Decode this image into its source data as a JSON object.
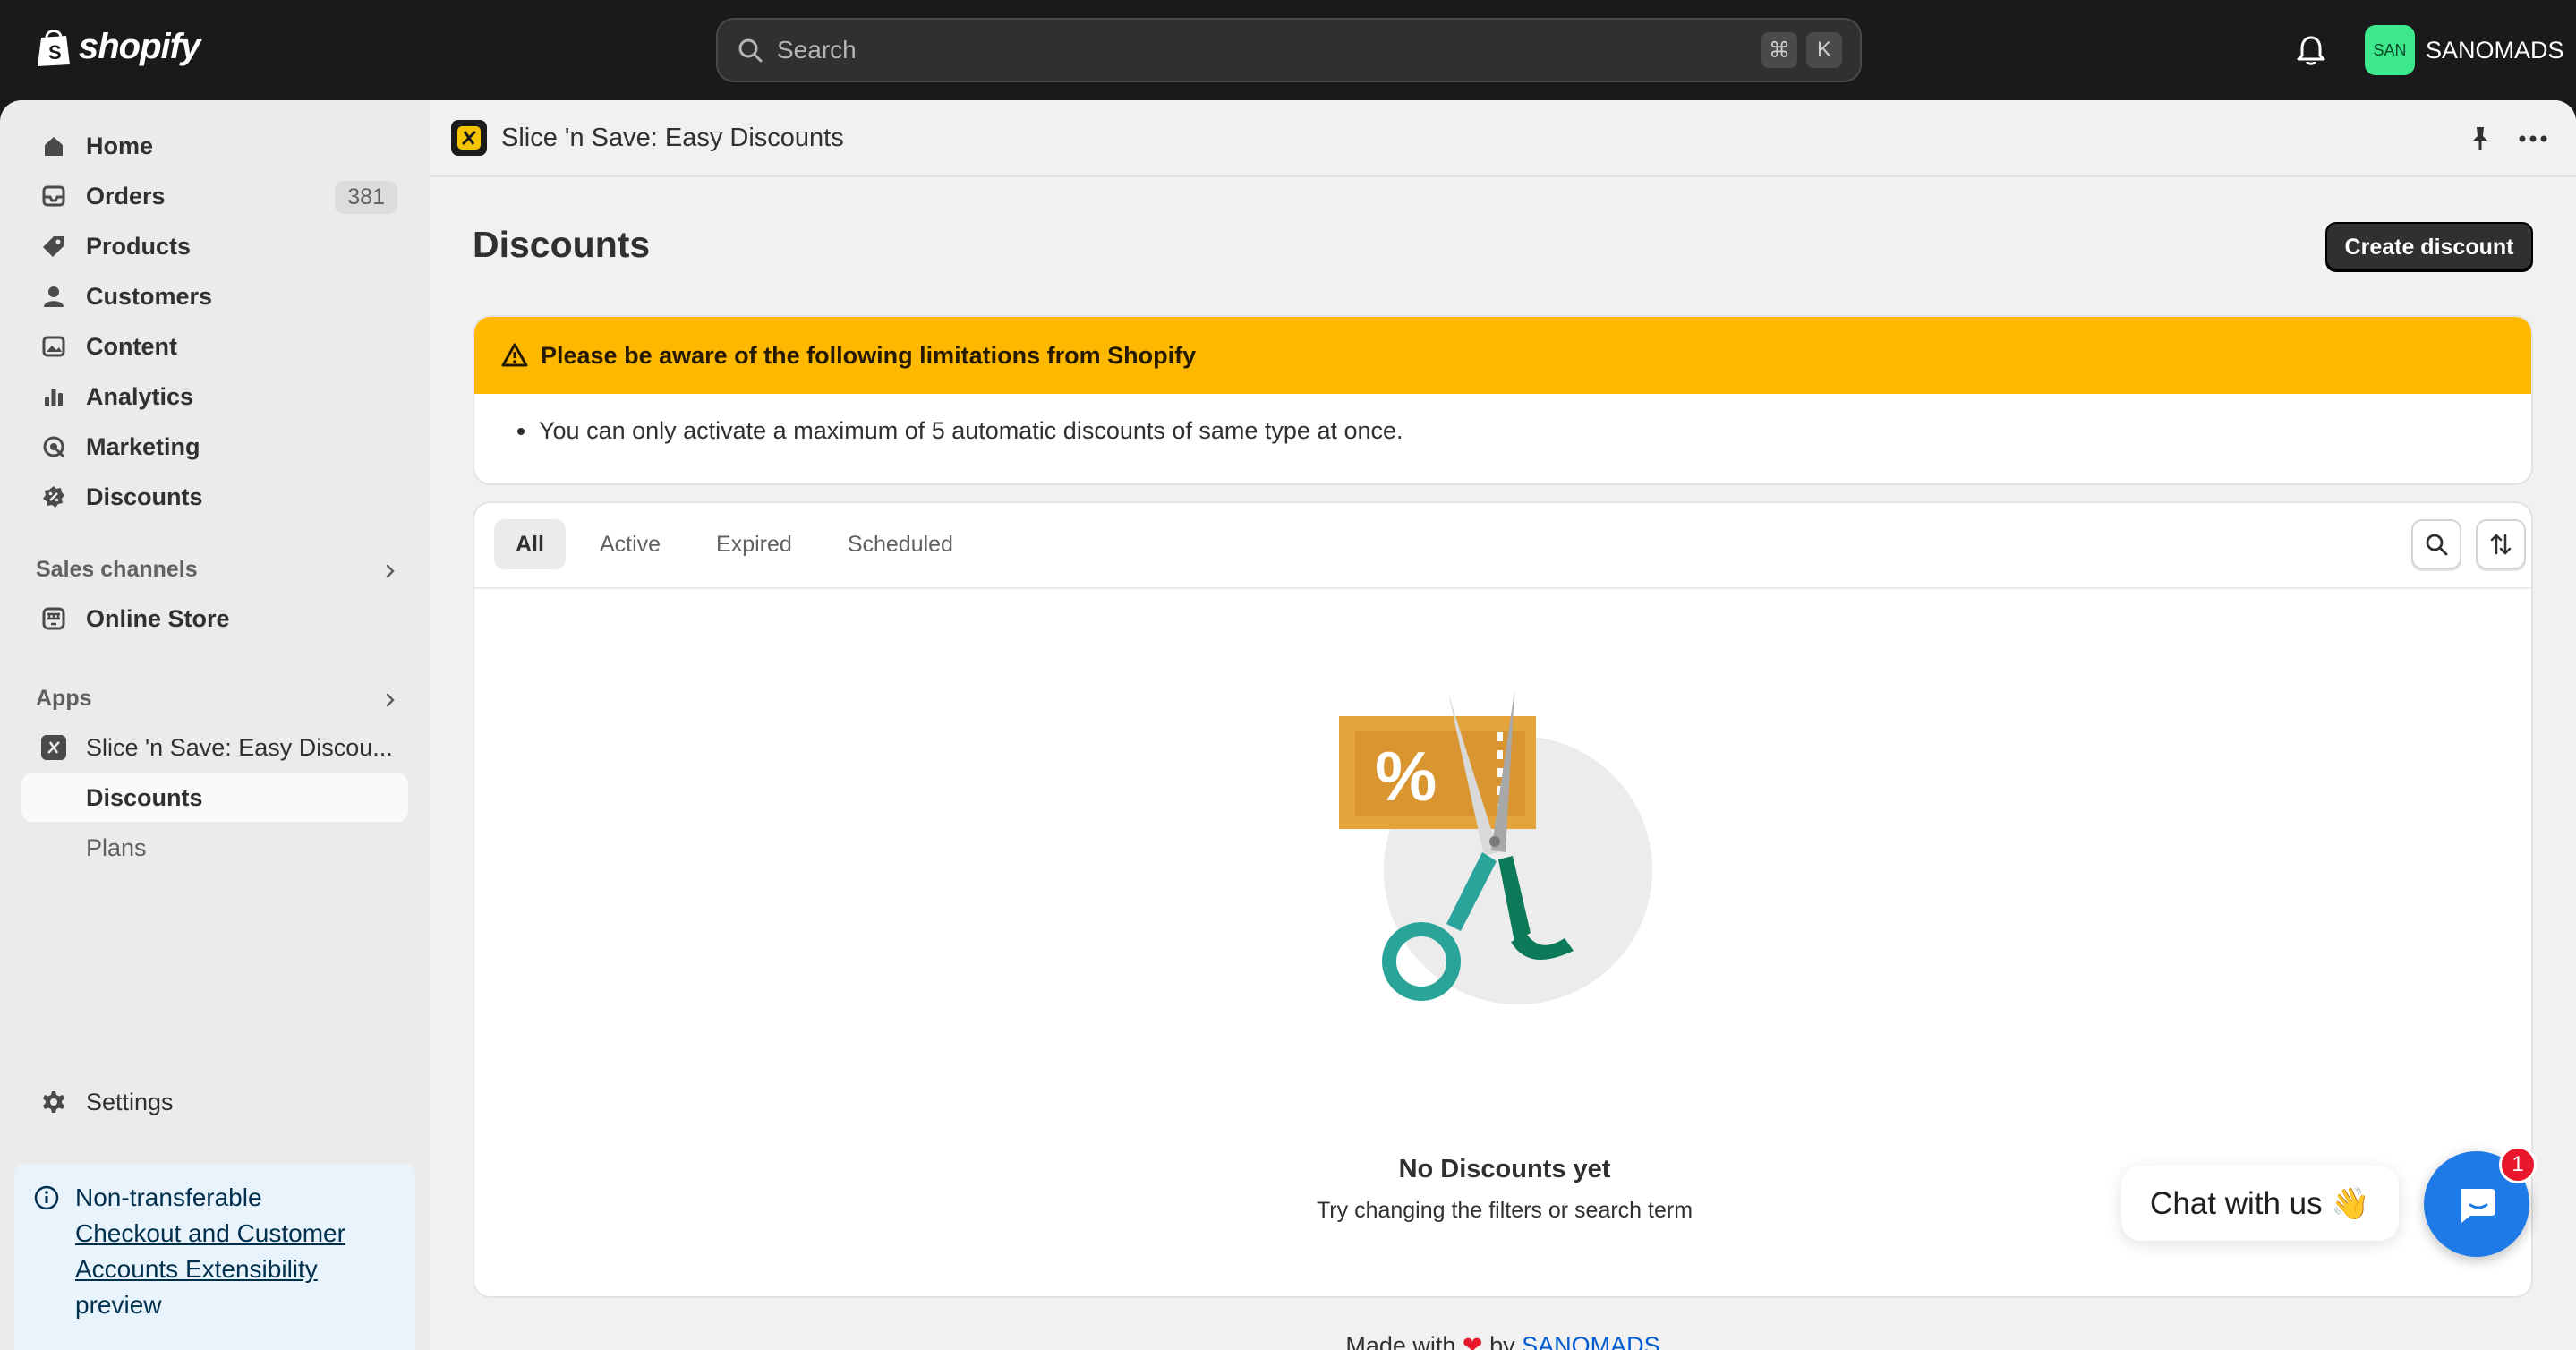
{
  "topbar": {
    "logo_text": "shopify",
    "search_placeholder": "Search",
    "shortcut_cmd": "⌘",
    "shortcut_key": "K",
    "avatar_initials": "SAN",
    "store_name": "SANOMADS"
  },
  "sidebar": {
    "items": [
      {
        "label": "Home",
        "icon": "home-icon"
      },
      {
        "label": "Orders",
        "icon": "inbox-icon",
        "count": "381"
      },
      {
        "label": "Products",
        "icon": "tag-icon"
      },
      {
        "label": "Customers",
        "icon": "person-icon"
      },
      {
        "label": "Content",
        "icon": "image-icon"
      },
      {
        "label": "Analytics",
        "icon": "bar-chart-icon"
      },
      {
        "label": "Marketing",
        "icon": "target-icon"
      },
      {
        "label": "Discounts",
        "icon": "discount-icon"
      }
    ],
    "sales_channels_heading": "Sales channels",
    "online_store_label": "Online Store",
    "apps_heading": "Apps",
    "app_label": "Slice 'n Save: Easy Discou...",
    "app_sub_items": [
      {
        "label": "Discounts"
      },
      {
        "label": "Plans"
      }
    ],
    "settings_label": "Settings",
    "notice": {
      "line1": "Non-transferable",
      "link": "Checkout and Customer Accounts Extensibility",
      "line3": "preview"
    }
  },
  "app_header": {
    "title": "Slice 'n Save: Easy Discounts"
  },
  "page": {
    "title": "Discounts",
    "create_button": "Create discount",
    "banner": {
      "title": "Please be aware of the following limitations from Shopify",
      "bullet": "You can only activate a maximum of 5 automatic discounts of same type at once."
    },
    "tabs": [
      {
        "label": "All"
      },
      {
        "label": "Active"
      },
      {
        "label": "Expired"
      },
      {
        "label": "Scheduled"
      }
    ],
    "empty_title": "No Discounts yet",
    "empty_subtitle": "Try changing the filters or search term",
    "illustration_symbol": "%"
  },
  "footer": {
    "prefix": "Made with",
    "heart": "❤",
    "by": "by",
    "brand": "SANOMADS"
  },
  "chat": {
    "label": "Chat with us 👋",
    "badge": "1"
  },
  "colors": {
    "accent_primary": "#303030",
    "warning": "#ffb800",
    "chat_blue": "#1e7ae6",
    "avatar_green": "#3ee88c",
    "link": "#005bd3"
  }
}
